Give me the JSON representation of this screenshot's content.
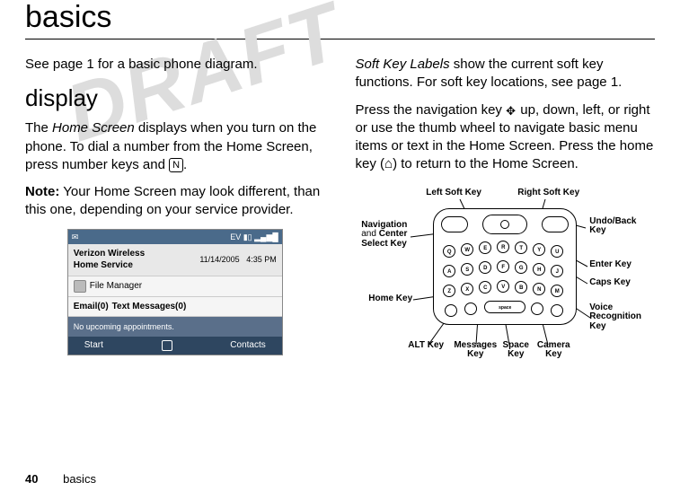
{
  "watermark": "DRAFT",
  "title": "basics",
  "footer": {
    "page": "40",
    "section": "basics"
  },
  "left": {
    "intro": "See page 1 for a basic phone diagram.",
    "heading": "display",
    "p1_a": "The ",
    "p1_home_screen": "Home Screen",
    "p1_b": " displays when you turn on the phone. To dial a number from the Home Screen, press number keys and ",
    "p1_key": "N",
    "p1_c": ".",
    "note_label": "Note:",
    "note_body": " Your Home Screen may look different, than this one, depending on your service provider."
  },
  "phone": {
    "status": {
      "ev": "EV",
      "signal": "▮▯",
      "bars": "▂▄▆█"
    },
    "carrier_line1": "Verizon Wireless",
    "carrier_line2": "Home Service",
    "date": "11/14/2005",
    "time": "4:35 PM",
    "file_manager": "File Manager",
    "email": "Email(0)",
    "texts": "Text Messages(0)",
    "no_appt": "No upcoming appointments.",
    "left_soft": "Start",
    "right_soft": "Contacts"
  },
  "right": {
    "p1_a": "Soft Key Labels",
    "p1_b": " show the current soft key functions. For soft key locations, see page 1.",
    "p2_a": "Press the navigation key ",
    "p2_b": " up, down, left, or right or use the thumb wheel to navigate basic menu items or text in the Home Screen. Press the home key (",
    "home_glyph": "⌂",
    "p2_c": ") to return to the Home Screen."
  },
  "diagram": {
    "left_soft": "Left Soft Key",
    "right_soft": "Right Soft Key",
    "nav_a": "Navigation",
    "nav_and": "and ",
    "nav_b": "Center",
    "nav_c": "Select Key",
    "undo": "Undo/Back Key",
    "enter": "Enter Key",
    "caps": "Caps Key",
    "home": "Home Key",
    "alt": "ALT Key",
    "messages": "Messages Key",
    "space": "Space Key",
    "camera": "Camera Key",
    "voice": "Voice Recognition Key"
  },
  "key_letters": {
    "r1": [
      "Q",
      "W",
      "E",
      "R",
      "T",
      "Y",
      "U"
    ],
    "r2": [
      "A",
      "S",
      "D",
      "F",
      "G",
      "H",
      "J"
    ],
    "r3": [
      "Z",
      "X",
      "C",
      "V",
      "B",
      "N",
      "M"
    ],
    "bottom": "space"
  }
}
